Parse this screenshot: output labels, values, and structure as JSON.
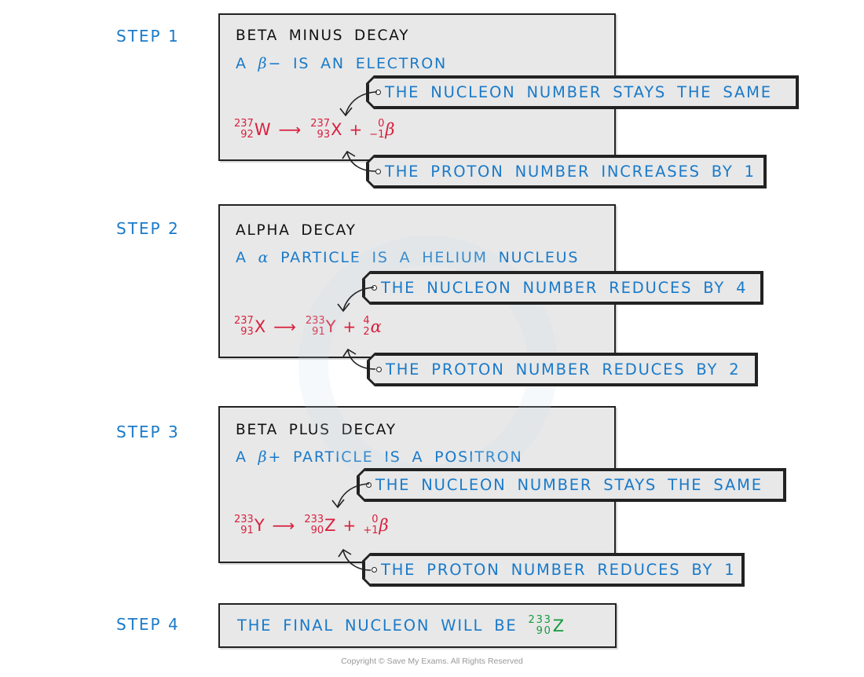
{
  "colors": {
    "blue_text": "#1a7ac9",
    "red_equation": "#d91f3d",
    "green_result": "#159a3e",
    "box_fill": "#e8e8e8",
    "border": "#222222"
  },
  "steps": [
    {
      "label": "STEP 1",
      "title": "BETA MINUS DECAY",
      "desc_pre": "A ",
      "desc_symbol": "β",
      "desc_post": "− IS AN ELECTRON",
      "equation": {
        "parent": {
          "mass": "237",
          "atomic": "92",
          "symbol": "W"
        },
        "arrow": "⟶",
        "daughter": {
          "mass": "237",
          "atomic": "93",
          "symbol": "X"
        },
        "plus": "+",
        "particle": {
          "mass": "0",
          "atomic": "−1",
          "symbol": "β"
        }
      },
      "nucleon_note": "THE NUCLEON NUMBER STAYS THE SAME",
      "proton_note": "THE PROTON NUMBER INCREASES BY 1"
    },
    {
      "label": "STEP 2",
      "title": "ALPHA DECAY",
      "desc_pre": "A ",
      "desc_symbol": "α",
      "desc_post": " PARTICLE IS A HELIUM NUCLEUS",
      "equation": {
        "parent": {
          "mass": "237",
          "atomic": "93",
          "symbol": "X"
        },
        "arrow": "⟶",
        "daughter": {
          "mass": "233",
          "atomic": "91",
          "symbol": "Y"
        },
        "plus": "+",
        "particle": {
          "mass": "4",
          "atomic": "2",
          "symbol": "α"
        }
      },
      "nucleon_note": "THE NUCLEON NUMBER REDUCES BY 4",
      "proton_note": "THE PROTON NUMBER REDUCES BY 2"
    },
    {
      "label": "STEP 3",
      "title": "BETA PLUS DECAY",
      "desc_pre": "A ",
      "desc_symbol": "β",
      "desc_post": "+ PARTICLE IS A POSITRON",
      "equation": {
        "parent": {
          "mass": "233",
          "atomic": "91",
          "symbol": "Y"
        },
        "arrow": "⟶",
        "daughter": {
          "mass": "233",
          "atomic": "90",
          "symbol": "Z"
        },
        "plus": "+",
        "particle": {
          "mass": "0",
          "atomic": "+1",
          "symbol": "β"
        }
      },
      "nucleon_note": "THE NUCLEON NUMBER STAYS THE SAME",
      "proton_note": "THE PROTON NUMBER REDUCES BY 1"
    },
    {
      "label": "STEP 4",
      "final_text": "THE FINAL NUCLEON WILL BE",
      "final_nucleus": {
        "mass": "233",
        "atomic": "90",
        "symbol": "Z"
      }
    }
  ],
  "copyright": "Copyright © Save My Exams. All Rights Reserved"
}
